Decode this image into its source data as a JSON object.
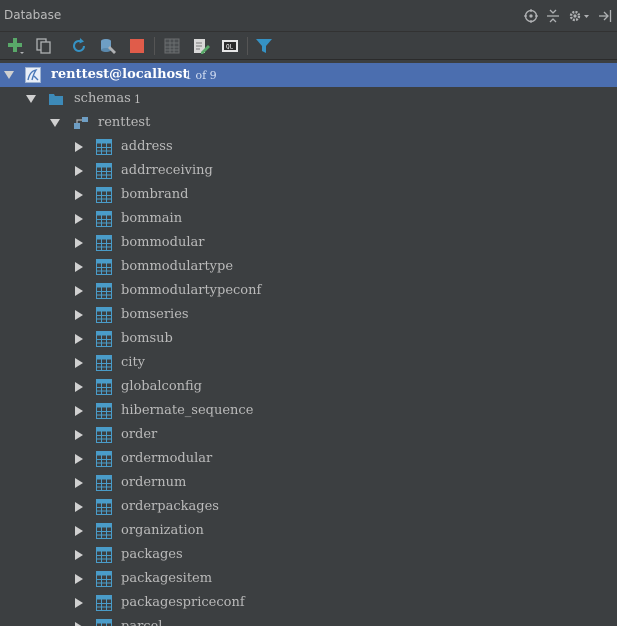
{
  "window": {
    "title": "Database"
  },
  "title_icons": [
    "target-icon",
    "collapse-all-icon",
    "settings-icon",
    "hide-panel-icon"
  ],
  "toolbar": {
    "buttons": [
      "add-icon",
      "copy-icon",
      "refresh-icon",
      "properties-icon",
      "stop-icon",
      "table-editor-icon",
      "edit-source-icon",
      "console-icon",
      "filter-icon"
    ]
  },
  "colors": {
    "background": "#3c3f41",
    "selection": "#4b6eaf",
    "table_icon": "#4a9cc9",
    "folder": "#3d8ab8",
    "add": "#59a869",
    "stop": "#e05c4a",
    "filter": "#3592c4"
  },
  "tree": {
    "connection": {
      "label": "renttest@localhost",
      "extra": "1 of 9"
    },
    "schemas": {
      "label": "schemas",
      "count": "1"
    },
    "schema": {
      "label": "renttest"
    },
    "tables": [
      "address",
      "addrreceiving",
      "bombrand",
      "bommain",
      "bommodular",
      "bommodulartype",
      "bommodulartypeconf",
      "bomseries",
      "bomsub",
      "city",
      "globalconfig",
      "hibernate_sequence",
      "order",
      "ordermodular",
      "ordernum",
      "orderpackages",
      "organization",
      "packages",
      "packagesitem",
      "packagespriceconf",
      "parcel"
    ]
  }
}
